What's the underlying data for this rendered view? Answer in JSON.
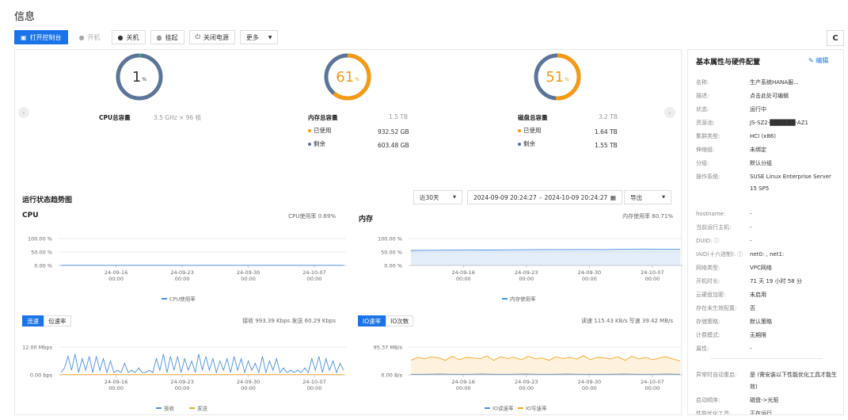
{
  "page_title": "信息",
  "toolbar": {
    "open_console": "打开控制台",
    "power_on": "开机",
    "shutdown": "关机",
    "suspend": "挂起",
    "power_off": "关闭电源",
    "more": "更多"
  },
  "gauges": {
    "cpu": {
      "percent": 1,
      "unit": "%",
      "label": "CPU总容量",
      "capacity": "3.5 GHz × 96 核"
    },
    "memory": {
      "percent": 61,
      "unit": "%",
      "label": "内存总容量",
      "capacity": "1.5 TB",
      "used_label": "已使用",
      "used": "932.52 GB",
      "free_label": "剩余",
      "free": "603.48 GB"
    },
    "disk": {
      "percent": 51,
      "unit": "%",
      "label": "磁盘总容量",
      "capacity": "3.2 TB",
      "used_label": "已使用",
      "used": "1.64 TB",
      "free_label": "剩余",
      "free": "1.55 TB"
    }
  },
  "colors": {
    "accent": "#1a73e8",
    "gauge_base": "#5b7598",
    "gauge_used": "#f59a12",
    "cpu_line": "#4a90e2",
    "green": "#2ecc71"
  },
  "trend": {
    "title": "运行状态趋势图",
    "range": "近30天",
    "start": "2024-09-09 20:24:27",
    "sep": "-",
    "end": "2024-10-09 20:24:27",
    "export": "导出"
  },
  "chart_data": [
    {
      "type": "line",
      "title": "CPU",
      "summary": "CPU使用率 0.69%",
      "yticks": [
        "100.00 %",
        "50.00 %",
        "0.00 %"
      ],
      "ylim": [
        0,
        100
      ],
      "xticks": [
        "24-09-16\n00:00",
        "24-09-23\n00:00",
        "24-09-30\n00:00",
        "24-10-07\n00:00"
      ],
      "series": [
        {
          "name": "CPU使用率",
          "values": [
            0.7,
            0.7,
            0.6,
            0.7,
            0.7,
            0.7,
            0.6,
            0.7,
            0.7,
            0.7
          ]
        }
      ]
    },
    {
      "type": "area",
      "title": "内存",
      "summary": "内存使用率 60.71%",
      "yticks": [
        "100.00 %",
        "50.00 %",
        "0.00 %"
      ],
      "ylim": [
        0,
        100
      ],
      "xticks": [
        "24-09-16\n00:00",
        "24-09-23\n00:00",
        "24-09-30\n00:00",
        "24-10-07\n00:00"
      ],
      "series": [
        {
          "name": "内存使用率",
          "values": [
            56,
            56.5,
            57,
            58,
            57.5,
            58,
            58.5,
            59,
            59,
            59.5,
            59,
            60,
            61,
            60.7,
            60.7
          ]
        }
      ]
    },
    {
      "type": "line",
      "tabs": [
        "流速",
        "包速率"
      ],
      "summary": "接收 993.39 Kbps  发送 60.29 Kbps",
      "yticks": [
        "12.00 Mbps",
        "0.00 bps"
      ],
      "ylim": [
        0,
        12
      ],
      "xticks": [
        "24-09-16\n00:00",
        "24-09-23\n00:00",
        "24-09-30\n00:00",
        "24-10-07\n00:00"
      ],
      "series": [
        {
          "name": "接收",
          "values": [
            1,
            3,
            8,
            2,
            9,
            1,
            7,
            2,
            8,
            1,
            8,
            2,
            7,
            1,
            6,
            1,
            2,
            1,
            5,
            1,
            2,
            1,
            3,
            1,
            1,
            2,
            1,
            7,
            2,
            9,
            1,
            8,
            2,
            8,
            1,
            7,
            2,
            6,
            1,
            9,
            2,
            8,
            2,
            7,
            1,
            6,
            2,
            7,
            1,
            8,
            2,
            7,
            1,
            6,
            2,
            5,
            1,
            8,
            1,
            6,
            2,
            7,
            1,
            3,
            1,
            2,
            1,
            2,
            1,
            3,
            1,
            7,
            2,
            8,
            1,
            7,
            2,
            6,
            1,
            5,
            2
          ]
        },
        {
          "name": "发送",
          "values": [
            0.1,
            0.1,
            0.1,
            0.1,
            0.1,
            0.1,
            0.1,
            0.1,
            0.1,
            0.1
          ]
        }
      ]
    },
    {
      "type": "area",
      "tabs": [
        "IO速率",
        "IO次数"
      ],
      "summary": "读速 115.43 KB/s  写速 39.42 MB/s",
      "yticks": [
        "95.37 MB/s",
        "0.00 B/s"
      ],
      "ylim": [
        0,
        95.37
      ],
      "xticks": [
        "24-09-16\n00:00",
        "24-09-23\n00:00",
        "24-09-30\n00:00",
        "24-10-07\n00:00"
      ],
      "series": [
        {
          "name": "IO读速率",
          "values": [
            2,
            2,
            3,
            2,
            2,
            3,
            2,
            2,
            3,
            2,
            2,
            3,
            2,
            2,
            2,
            3,
            2,
            2,
            3,
            2
          ]
        },
        {
          "name": "IO写速率",
          "values": [
            50,
            60,
            55,
            62,
            58,
            50,
            64,
            52,
            60,
            58,
            55,
            65,
            50,
            62,
            56,
            60,
            52,
            64,
            55,
            58,
            50,
            62,
            56,
            60,
            54,
            66,
            52,
            60,
            58,
            55,
            62,
            50,
            64,
            55,
            60,
            52,
            58,
            62,
            54,
            48
          ]
        }
      ]
    }
  ],
  "side": {
    "title": "基本属性与硬件配置",
    "edit": "编辑",
    "props": [
      {
        "k": "名称:",
        "v": "生产系统HANA服..."
      },
      {
        "k": "描述:",
        "v": "点击此处可编辑"
      },
      {
        "k": "状态:",
        "v": "运行中"
      },
      {
        "k": "资源池:",
        "v": "JS-SZ2-██████-AZ1"
      },
      {
        "k": "集群类型:",
        "v": "HCI (x86)"
      },
      {
        "k": "伸缩组:",
        "v": "未绑定"
      },
      {
        "k": "分组:",
        "v": "默认分组"
      },
      {
        "k": "操作系统:",
        "v": "SUSE Linux Enterprise Server 15 SP5"
      },
      {
        "k": "hostname:",
        "v": "-"
      },
      {
        "k": "当前运行主机:",
        "v": "-"
      },
      {
        "k": "DUID: ⓘ",
        "v": "-"
      },
      {
        "k": "IAID(十六进制): ⓘ",
        "v": "net0: , net1:"
      },
      {
        "k": "网络类型:",
        "v": "VPC网络"
      },
      {
        "k": "开机时长:",
        "v": "71 天 19 小时 58 分"
      },
      {
        "k": "云硬盘加密:",
        "v": "未启用"
      },
      {
        "k": "存在未生效配置:",
        "v": "否"
      },
      {
        "k": "存储策略:",
        "v": "默认策略"
      },
      {
        "k": "计费模式:",
        "v": "无期限"
      },
      {
        "k": "属性:",
        "v": "-"
      },
      {
        "k": "异常时自动重启:",
        "v": "是 (需安装以下性能优化工具才能生效)"
      },
      {
        "k": "启动顺序:",
        "v": "磁盘->光驱"
      },
      {
        "k": "性能优化工具:",
        "v": "正在运行"
      }
    ]
  }
}
